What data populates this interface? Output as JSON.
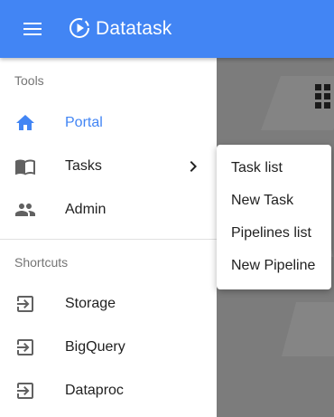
{
  "app": {
    "title": "Datatask",
    "menu_icon": "menu-icon",
    "logo_icon": "play-circle-logo"
  },
  "colors": {
    "primary": "#4285f4",
    "text": "#212121",
    "muted": "#757575",
    "icon": "#616161"
  },
  "drawer": {
    "tools_header": "Tools",
    "tools": [
      {
        "label": "Portal",
        "icon": "home-icon",
        "active": true
      },
      {
        "label": "Tasks",
        "icon": "book-icon",
        "has_submenu": true
      },
      {
        "label": "Admin",
        "icon": "people-icon"
      }
    ],
    "shortcuts_header": "Shortcuts",
    "shortcuts": [
      {
        "label": "Storage",
        "icon": "login-icon"
      },
      {
        "label": "BigQuery",
        "icon": "login-icon"
      },
      {
        "label": "Dataproc",
        "icon": "login-icon"
      }
    ]
  },
  "submenu": {
    "items": [
      {
        "label": "Task list"
      },
      {
        "label": "New Task"
      },
      {
        "label": "Pipelines list"
      },
      {
        "label": "New Pipeline"
      }
    ]
  }
}
